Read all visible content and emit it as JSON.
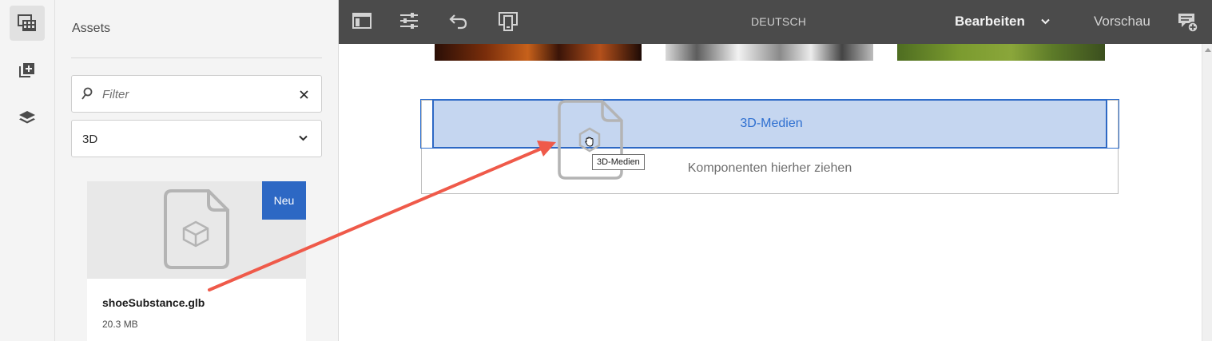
{
  "rail": {
    "items": [
      {
        "name": "assets-panel-icon",
        "active": true
      },
      {
        "name": "components-icon",
        "active": false
      },
      {
        "name": "content-tree-icon",
        "active": false
      }
    ]
  },
  "assets": {
    "title": "Assets",
    "filter": {
      "value": "",
      "placeholder": "Filter"
    },
    "type_select": {
      "value": "3D"
    },
    "card": {
      "badge": "Neu",
      "name": "shoeSubstance.glb",
      "size": "20.3 MB"
    }
  },
  "toolbar": {
    "language": "DEUTSCH",
    "mode": "Bearbeiten",
    "preview": "Vorschau"
  },
  "canvas": {
    "dropzone_label": "3D-Medien",
    "drop_hint": "Komponenten hierher ziehen",
    "tooltip": "3D-Medien"
  },
  "colors": {
    "accent": "#2d68c4",
    "annotation_arrow": "#ef5a4a",
    "toolbar": "#4b4b4b"
  }
}
